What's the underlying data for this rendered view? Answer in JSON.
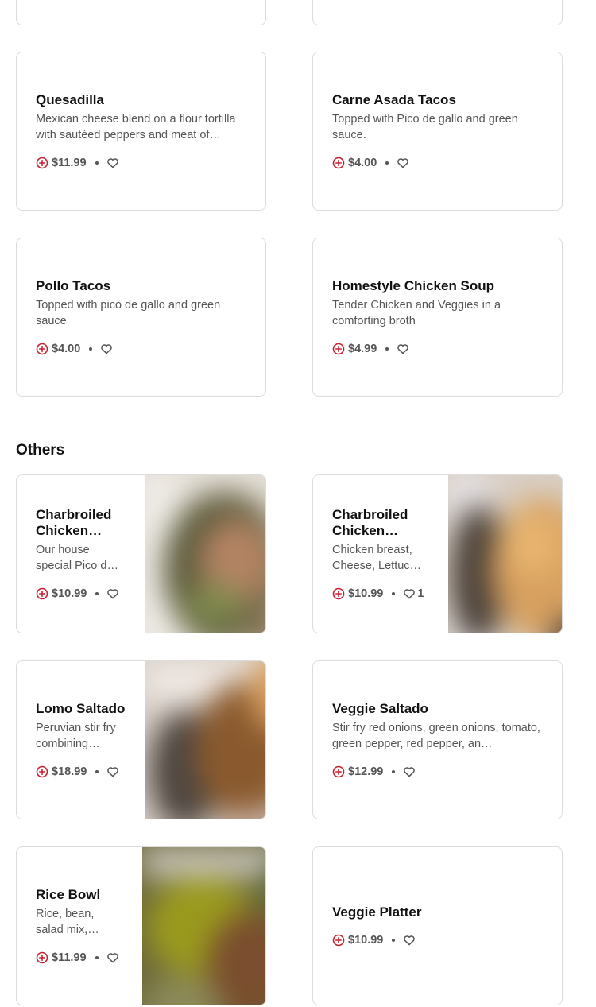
{
  "colors": {
    "accent": "#c8202f",
    "text_primary": "#111111",
    "text_secondary": "#555555",
    "border": "#dcdcdc"
  },
  "icons": {
    "add": "circle-plus-icon",
    "favorite": "heart-outline-icon"
  },
  "sections": {
    "others_title": "Others"
  },
  "items": [
    {
      "name": "Quesadilla",
      "description": "Mexican cheese blend on a flour tortilla with sautéed peppers and meat of…",
      "price": "$11.99",
      "likes": ""
    },
    {
      "name": "Carne Asada Tacos",
      "description": "Topped with Pico de gallo and green sauce.",
      "price": "$4.00",
      "likes": ""
    },
    {
      "name": "Pollo Tacos",
      "description": "Topped with pico de gallo and green sauce",
      "price": "$4.00",
      "likes": ""
    },
    {
      "name": "Homestyle Chicken Soup",
      "description": "Tender Chicken and Veggies in a comforting broth",
      "price": "$4.99",
      "likes": ""
    },
    {
      "name": "Charbroiled Chicken…",
      "description": "Our house special Pico d…",
      "price": "$10.99",
      "likes": ""
    },
    {
      "name": "Charbroiled Chicken…",
      "description": "Chicken breast, Cheese, Lettuc…",
      "price": "$10.99",
      "likes": "1"
    },
    {
      "name": "Lomo Saltado",
      "description": "Peruvian stir fry combining…",
      "price": "$18.99",
      "likes": ""
    },
    {
      "name": "Veggie Saltado",
      "description": "Stir fry red onions, green onions, tomato, green pepper, red pepper, an…",
      "price": "$12.99",
      "likes": ""
    },
    {
      "name": "Rice Bowl",
      "description": "Rice, bean, salad mix,…",
      "price": "$11.99",
      "likes": ""
    },
    {
      "name": "Veggie Platter",
      "description": "",
      "price": "$10.99",
      "likes": ""
    }
  ]
}
